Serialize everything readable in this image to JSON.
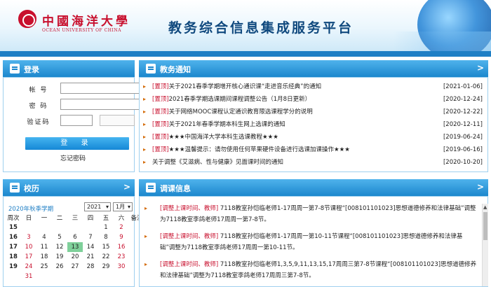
{
  "header": {
    "logo_cn": "中國海洋大學",
    "logo_en": "OCEAN UNIVERSITY OF CHINA",
    "title": "教务综合信息集成服务平台"
  },
  "login": {
    "title": "登录",
    "account_label": "帐 号",
    "password_label": "密 码",
    "captcha_label": "验证码",
    "submit_label": "登 录",
    "forgot_label": "忘记密码"
  },
  "notices": {
    "title": "教务通知",
    "more": ">",
    "items": [
      {
        "tag": "[置顶]",
        "text": "关于2021春季学期增开核心通识课“走进音乐经典”的通知",
        "date": "[2021-01-06]"
      },
      {
        "tag": "[置顶]",
        "text": "2021春季学期选课期间课程调整公告（1月8日更新）",
        "date": "[2020-12-24]"
      },
      {
        "tag": "[置顶]",
        "text": "关于网络MOOC课程认定通识教育限选课程学分的说明",
        "date": "[2020-12-22]"
      },
      {
        "tag": "[置顶]",
        "text": "关于2021年春季学期本科生网上选课的通知",
        "date": "[2020-12-11]"
      },
      {
        "tag": "[置顶]",
        "text": "★★★中国海洋大学本科生选课教程★★★",
        "date": "[2019-06-24]"
      },
      {
        "tag": "[置顶]",
        "text": "★★★温馨提示：请勿使用任何苹果硬件设备进行选课加课操作★★★",
        "date": "[2019-06-16]"
      },
      {
        "tag": "",
        "text": "关于调整《艾滋病、性与健康》见面课时间的通知",
        "date": "[2020-10-20]"
      }
    ]
  },
  "calendar": {
    "title": "校历",
    "more": ">",
    "term": "2020年秋季学期",
    "year_select": "2021",
    "month_select": "1月",
    "headers": [
      "周次",
      "日",
      "一",
      "二",
      "三",
      "四",
      "五",
      "六",
      "备注"
    ],
    "rows": [
      [
        "15",
        "",
        "",
        "",
        "",
        "",
        "1",
        "2",
        ""
      ],
      [
        "16",
        "3",
        "4",
        "5",
        "6",
        "7",
        "8",
        "9",
        ""
      ],
      [
        "17",
        "10",
        "11",
        "12",
        "13",
        "14",
        "15",
        "16",
        ""
      ],
      [
        "18",
        "17",
        "18",
        "19",
        "20",
        "21",
        "22",
        "23",
        ""
      ],
      [
        "19",
        "24",
        "25",
        "26",
        "27",
        "28",
        "29",
        "30",
        ""
      ],
      [
        "",
        "31",
        "",
        "",
        "",
        "",
        "",
        "",
        ""
      ]
    ],
    "today": "13"
  },
  "schedule": {
    "title": "调课信息",
    "more": ">",
    "items": [
      {
        "tag": "[调整上课时间、教师]",
        "text": " 7118教室孙恺临老师1-17周周一第7-8节课程“[008101101023]思想道德修养和法律基础”调整为7118教室李鸽老师17周周一第7-8节。"
      },
      {
        "tag": "[调整上课时间、教师]",
        "text": " 7118教室孙恺临老师1-17周周一第10-11节课程“[008101101023]思想道德修养和法律基础”调整为7118教室李鸽老师17周周一第10-11节。"
      },
      {
        "tag": "[调整上课时间、教师]",
        "text": " 7118教室孙恺临老师1,3,5,9,11,13,15,17周周三第7-8节课程“[008101101023]思想道德修养和法律基础”调整为7118教室李鸽老师17周周三第7-8节。"
      }
    ]
  },
  "colors": {
    "brand_red": "#c8102e",
    "header_blue": "#1f7fc5",
    "title_blue": "#10497e",
    "today_green": "#7fd09a"
  }
}
